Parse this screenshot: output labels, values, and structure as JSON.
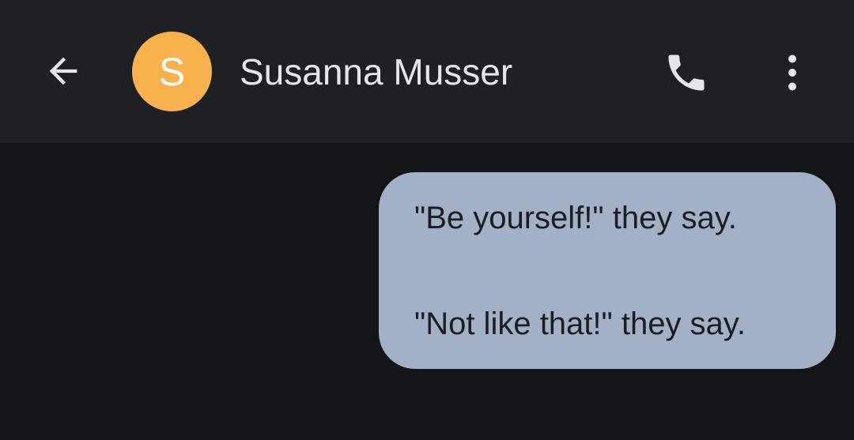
{
  "header": {
    "back_icon": "arrow-left-icon",
    "avatar_initial": "S",
    "avatar_color": "#f7b24e",
    "contact_name": "Susanna Musser",
    "call_icon": "phone-icon",
    "menu_icon": "more-vertical-icon"
  },
  "conversation": {
    "messages": [
      {
        "direction": "outgoing",
        "bubble_color": "#a3b1c6",
        "lines": [
          "\"Be yourself!\" they say.",
          "\"Not like that!\" they say."
        ]
      }
    ]
  }
}
